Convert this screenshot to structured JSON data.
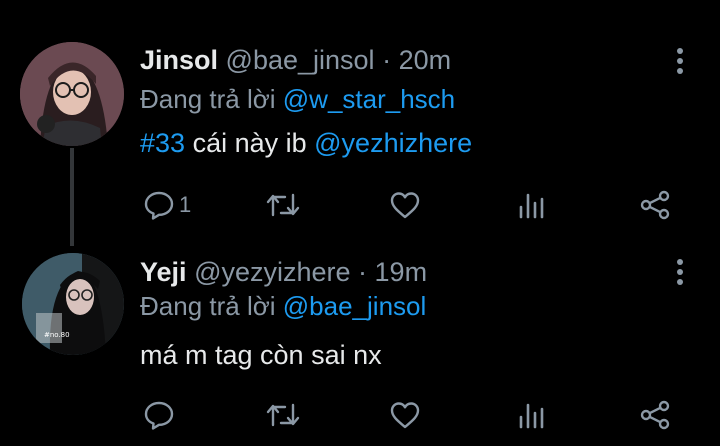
{
  "theme": {
    "background": "#000000",
    "text": "#e7e9ea",
    "muted": "#8b98a5",
    "link": "#1d9bf0",
    "icon": "#8b98a5"
  },
  "tweets": [
    {
      "name": "Jinsol",
      "handle": "@bae_jinsol",
      "separator": " · ",
      "time": "20m",
      "reply_prefix": "Đang trả lời ",
      "reply_to": "@w_star_hsch",
      "body_tag": "#33",
      "body_text": " cái này ib ",
      "body_mention": "@yezhizhere",
      "reply_count": "1",
      "icons": [
        "comment-icon",
        "retweet-icon",
        "like-icon",
        "stats-icon",
        "share-icon",
        "more-icon"
      ]
    },
    {
      "name": "Yeji",
      "handle": "@yezyizhere",
      "separator": " · ",
      "time": "19m",
      "reply_prefix": "Đang trả lời ",
      "reply_to": "@bae_jinsol",
      "body_text": "má m tag còn sai nx",
      "reply_count": "",
      "avatar_caption": "#no.80",
      "icons": [
        "comment-icon",
        "retweet-icon",
        "like-icon",
        "stats-icon",
        "share-icon",
        "more-icon"
      ]
    }
  ]
}
